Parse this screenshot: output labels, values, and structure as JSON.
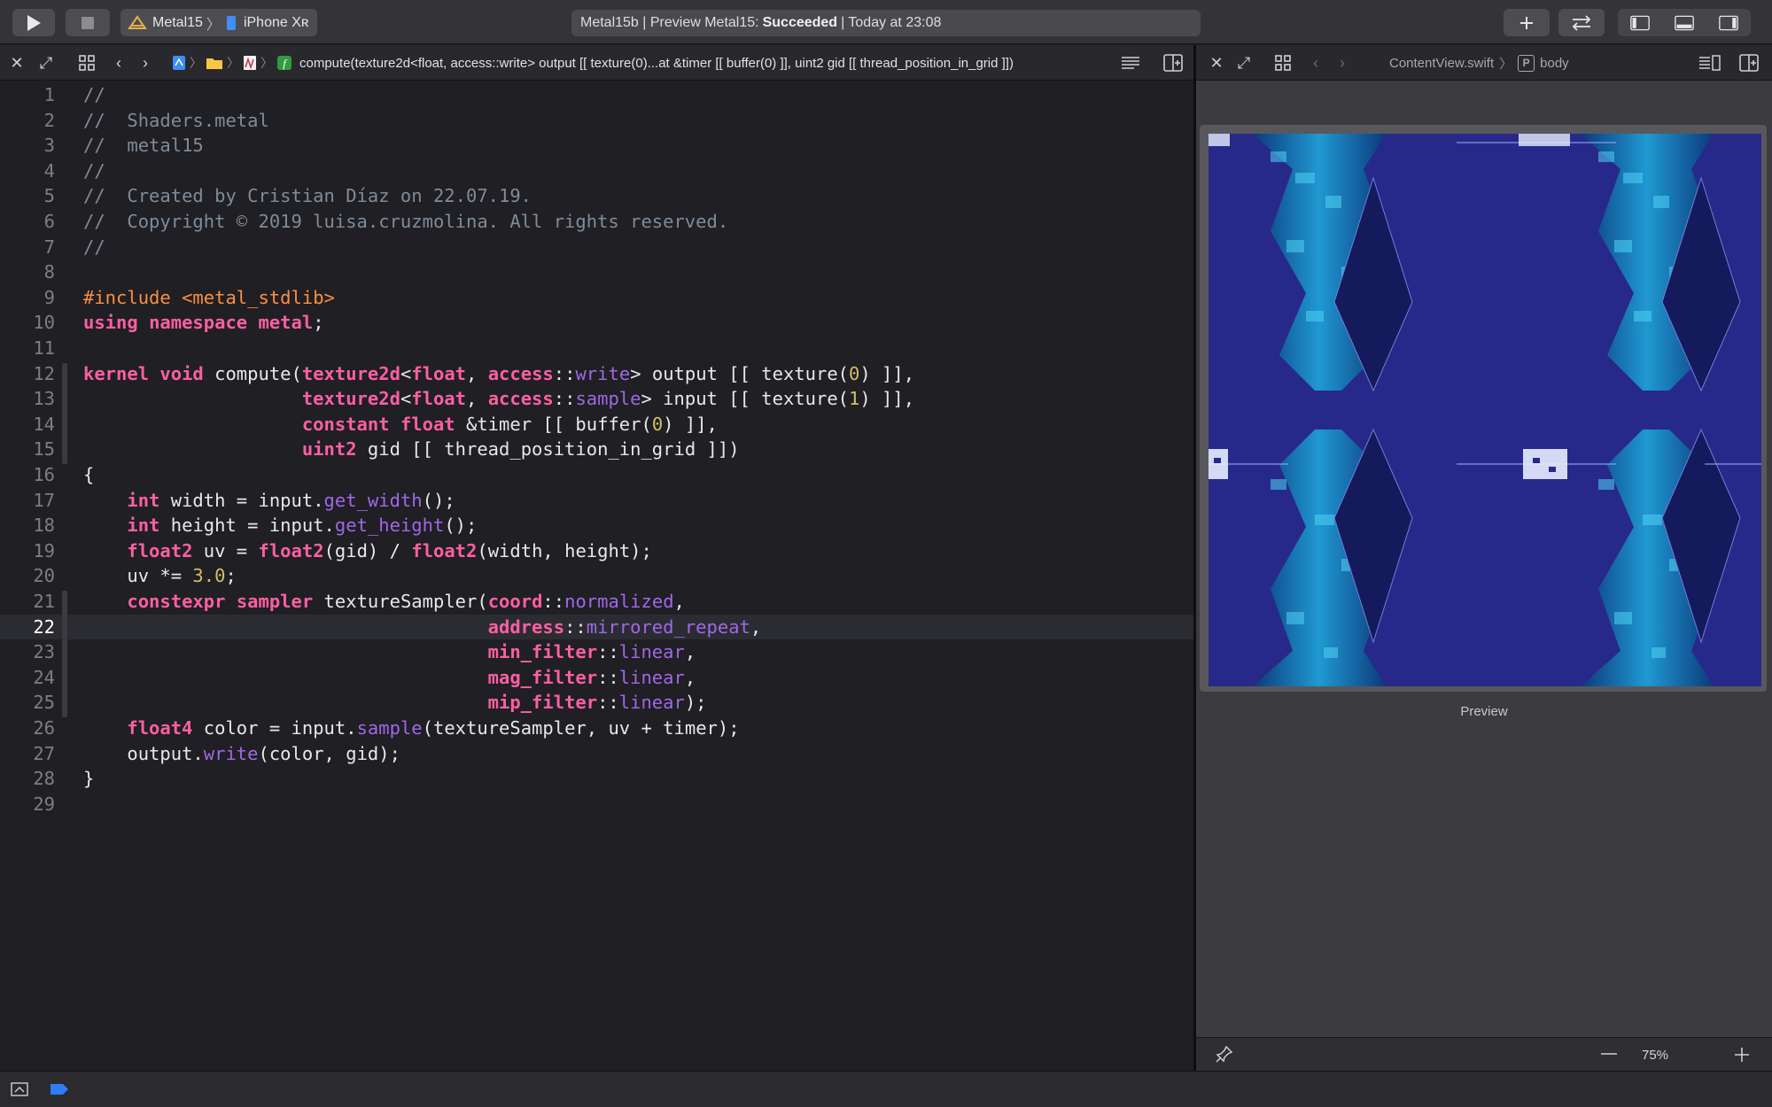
{
  "toolbar": {
    "scheme_project": "Metal15",
    "scheme_device": "iPhone Xʀ",
    "status_prefix": "Metal15b | Preview Metal15:",
    "status_result": "Succeeded",
    "status_suffix": "| Today at 23:08",
    "icons": [
      "play-icon",
      "stop-icon",
      "plus-icon",
      "swap-arrows-icon",
      "navigator-panel-icon",
      "debug-panel-icon",
      "inspector-panel-icon"
    ]
  },
  "left_editor": {
    "breadcrumb_function": "compute(texture2d<float, access::write> output [[ texture(0)...at &timer [[ buffer(0) ]], uint2 gid [[ thread_position_in_grid ]])",
    "current_line": 22,
    "lines": [
      {
        "n": "1",
        "code": "//"
      },
      {
        "n": "2",
        "code": "//  Shaders.metal"
      },
      {
        "n": "3",
        "code": "//  metal15"
      },
      {
        "n": "4",
        "code": "//"
      },
      {
        "n": "5",
        "code": "//  Created by Cristian Díaz on 22.07.19."
      },
      {
        "n": "6",
        "code": "//  Copyright © 2019 luisa.cruzmolina. All rights reserved."
      },
      {
        "n": "7",
        "code": "//"
      },
      {
        "n": "8",
        "code": ""
      },
      {
        "n": "9",
        "code": "#include <metal_stdlib>"
      },
      {
        "n": "10",
        "code": "using namespace metal;"
      },
      {
        "n": "11",
        "code": ""
      },
      {
        "n": "12",
        "code": "kernel void compute(texture2d<float, access::write> output [[ texture(0) ]],"
      },
      {
        "n": "13",
        "code": "                    texture2d<float, access::sample> input [[ texture(1) ]],"
      },
      {
        "n": "14",
        "code": "                    constant float &timer [[ buffer(0) ]],"
      },
      {
        "n": "15",
        "code": "                    uint2 gid [[ thread_position_in_grid ]])"
      },
      {
        "n": "16",
        "code": "{"
      },
      {
        "n": "17",
        "code": "    int width = input.get_width();"
      },
      {
        "n": "18",
        "code": "    int height = input.get_height();"
      },
      {
        "n": "19",
        "code": "    float2 uv = float2(gid) / float2(width, height);"
      },
      {
        "n": "20",
        "code": "    uv *= 3.0;"
      },
      {
        "n": "21",
        "code": "    constexpr sampler textureSampler(coord::normalized,"
      },
      {
        "n": "22",
        "code": "                                     address::mirrored_repeat,"
      },
      {
        "n": "23",
        "code": "                                     min_filter::linear,"
      },
      {
        "n": "24",
        "code": "                                     mag_filter::linear,"
      },
      {
        "n": "25",
        "code": "                                     mip_filter::linear);"
      },
      {
        "n": "26",
        "code": "    float4 color = input.sample(textureSampler, uv + timer);"
      },
      {
        "n": "27",
        "code": "    output.write(color, gid);"
      },
      {
        "n": "28",
        "code": "}"
      },
      {
        "n": "29",
        "code": ""
      }
    ]
  },
  "right_editor": {
    "file": "ContentView.swift",
    "symbol_badge": "P",
    "symbol": "body",
    "preview_label": "Preview",
    "zoom": "75%"
  },
  "colors": {
    "keyword": "#fc5fa3",
    "comment": "#7f8c98",
    "preprocessor": "#fd8f3f",
    "number": "#d0bf69",
    "function": "#a167e6",
    "status_success": "#ffffff"
  }
}
